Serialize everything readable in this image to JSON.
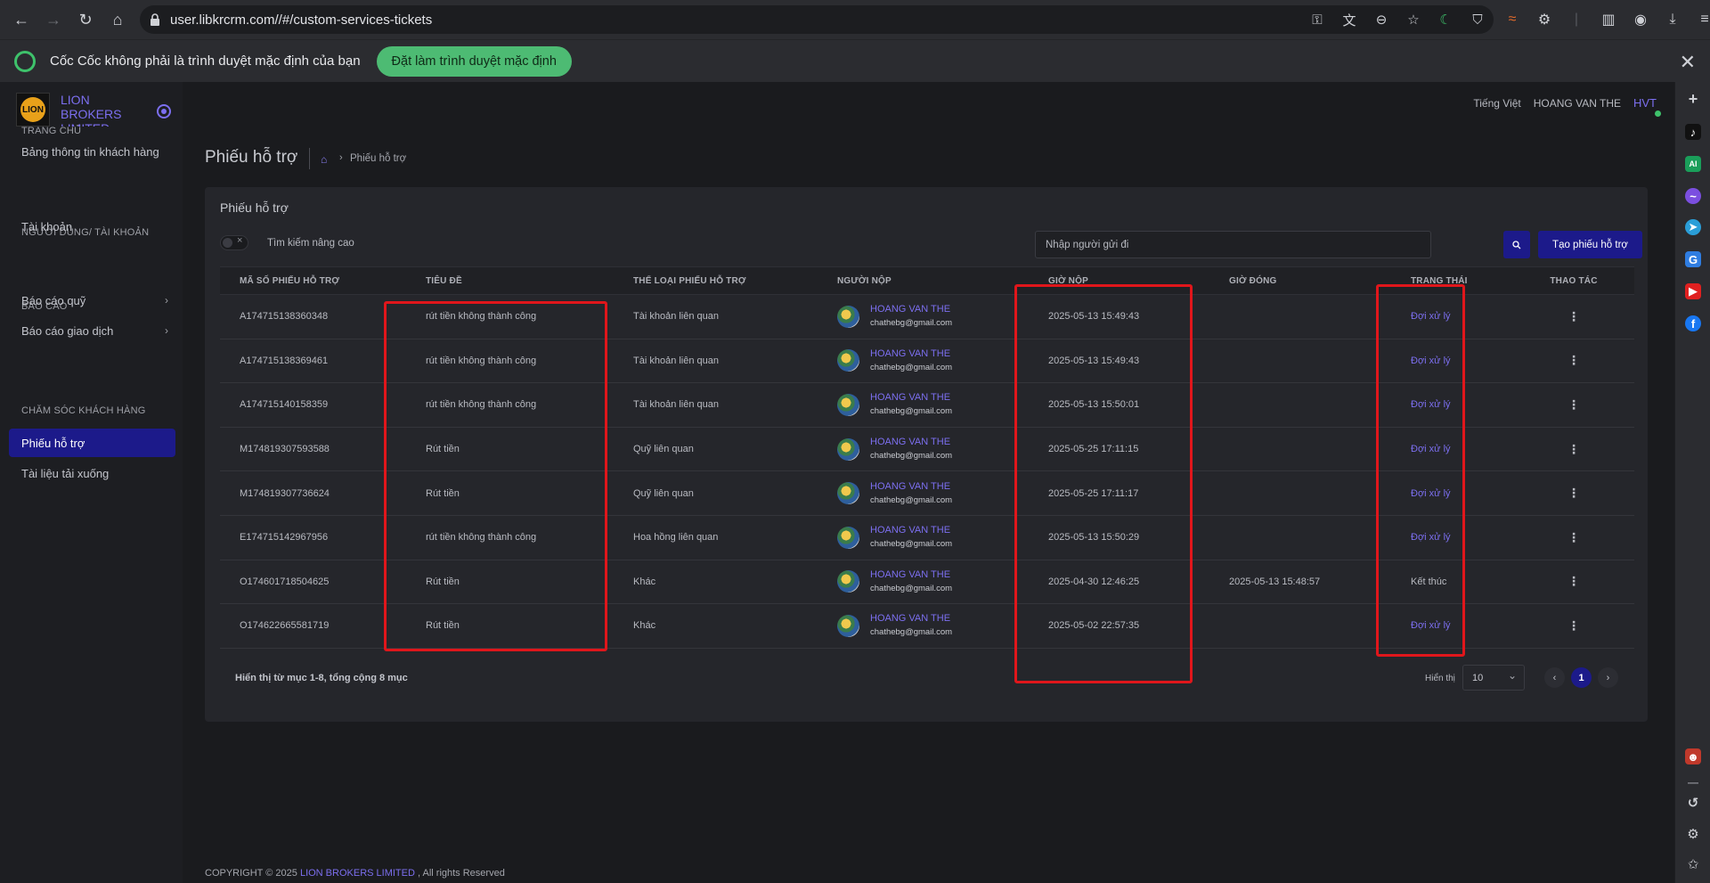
{
  "browser": {
    "url": "user.libkrcrm.com//#/custom-services-tickets",
    "infobar_text": "Cốc Cốc không phải là trình duyệt mặc định của bạn",
    "infobar_button": "Đặt làm trình duyệt mặc định"
  },
  "brand": {
    "name": "LION BROKERS LIMITED",
    "logo_text": "LION"
  },
  "topbar": {
    "language": "Tiếng Việt",
    "user_name": "HOANG VAN THE",
    "avatar_initials": "HVT"
  },
  "sidebar": {
    "sections": [
      {
        "title": "TRANG CHỦ",
        "items": [
          {
            "label": "Bảng thông tin khách hàng"
          }
        ]
      },
      {
        "title": "NGƯỜI DÙNG/ TÀI KHOẢN",
        "items": [
          {
            "label": "Tài khoản"
          }
        ]
      },
      {
        "title": "BÁO CÁO",
        "items": [
          {
            "label": "Báo cáo quỹ"
          },
          {
            "label": "Báo cáo giao dịch"
          }
        ]
      },
      {
        "title": "CHĂM SÓC KHÁCH HÀNG",
        "items": [
          {
            "label": "Phiếu hỗ trợ"
          },
          {
            "label": "Tài liệu tải xuống"
          }
        ]
      }
    ]
  },
  "page": {
    "title": "Phiếu hỗ trợ",
    "breadcrumb_current": "Phiếu hỗ trợ",
    "card_title": "Phiếu hỗ trợ",
    "advanced_search_label": "Tìm kiếm nâng cao",
    "search_placeholder": "Nhập người gửi đi",
    "create_button": "Tạo phiếu hỗ trợ"
  },
  "table": {
    "columns": [
      "MÃ SỐ PHIẾU HỖ TRỢ",
      "TIÊU ĐỀ",
      "THỂ LOẠI PHIẾU HỖ TRỢ",
      "NGƯỜI NỘP",
      "GIỜ NỘP",
      "GIỜ ĐÓNG",
      "TRẠNG THÁI",
      "THAO TÁC"
    ],
    "rows": [
      {
        "id": "A174715138360348",
        "title": "rút tiền không thành công",
        "category": "Tài khoản liên quan",
        "user": "HOANG VAN THE",
        "email": "chathebg@gmail.com",
        "submitted": "2025-05-13 15:49:43",
        "closed": "",
        "status": "Đợi xử lý",
        "status_type": "pending"
      },
      {
        "id": "A174715138369461",
        "title": "rút tiền không thành công",
        "category": "Tài khoản liên quan",
        "user": "HOANG VAN THE",
        "email": "chathebg@gmail.com",
        "submitted": "2025-05-13 15:49:43",
        "closed": "",
        "status": "Đợi xử lý",
        "status_type": "pending"
      },
      {
        "id": "A174715140158359",
        "title": "rút tiền không thành công",
        "category": "Tài khoản liên quan",
        "user": "HOANG VAN THE",
        "email": "chathebg@gmail.com",
        "submitted": "2025-05-13 15:50:01",
        "closed": "",
        "status": "Đợi xử lý",
        "status_type": "pending"
      },
      {
        "id": "M174819307593588",
        "title": "Rút tiền",
        "category": "Quỹ liên quan",
        "user": "HOANG VAN THE",
        "email": "chathebg@gmail.com",
        "submitted": "2025-05-25 17:11:15",
        "closed": "",
        "status": "Đợi xử lý",
        "status_type": "pending"
      },
      {
        "id": "M174819307736624",
        "title": "Rút tiền",
        "category": "Quỹ liên quan",
        "user": "HOANG VAN THE",
        "email": "chathebg@gmail.com",
        "submitted": "2025-05-25 17:11:17",
        "closed": "",
        "status": "Đợi xử lý",
        "status_type": "pending"
      },
      {
        "id": "E174715142967956",
        "title": "rút tiền không thành công",
        "category": "Hoa hồng liên quan",
        "user": "HOANG VAN THE",
        "email": "chathebg@gmail.com",
        "submitted": "2025-05-13 15:50:29",
        "closed": "",
        "status": "Đợi xử lý",
        "status_type": "pending"
      },
      {
        "id": "O174601718504625",
        "title": "Rút tiền",
        "category": "Khác",
        "user": "HOANG VAN THE",
        "email": "chathebg@gmail.com",
        "submitted": "2025-04-30 12:46:25",
        "closed": "2025-05-13 15:48:57",
        "status": "Kết thúc",
        "status_type": "done"
      },
      {
        "id": "O174622665581719",
        "title": "Rút tiền",
        "category": "Khác",
        "user": "HOANG VAN THE",
        "email": "chathebg@gmail.com",
        "submitted": "2025-05-02 22:57:35",
        "closed": "",
        "status": "Đợi xử lý",
        "status_type": "pending"
      }
    ]
  },
  "pagination": {
    "summary": "Hiển thị từ mục 1-8, tổng cộng 8 mục",
    "per_page_label": "Hiển thị",
    "per_page_value": "10",
    "current_page": "1",
    "prev_symbol": "‹",
    "next_symbol": "›"
  },
  "footer": {
    "prefix": "COPYRIGHT © 2025",
    "brand": "LION BROKERS LIMITED",
    "suffix": ", All rights Reserved"
  },
  "colors": {
    "accent": "#7c6ff0",
    "primary_button": "#1c1a8a",
    "highlight_box": "#e0161b"
  }
}
